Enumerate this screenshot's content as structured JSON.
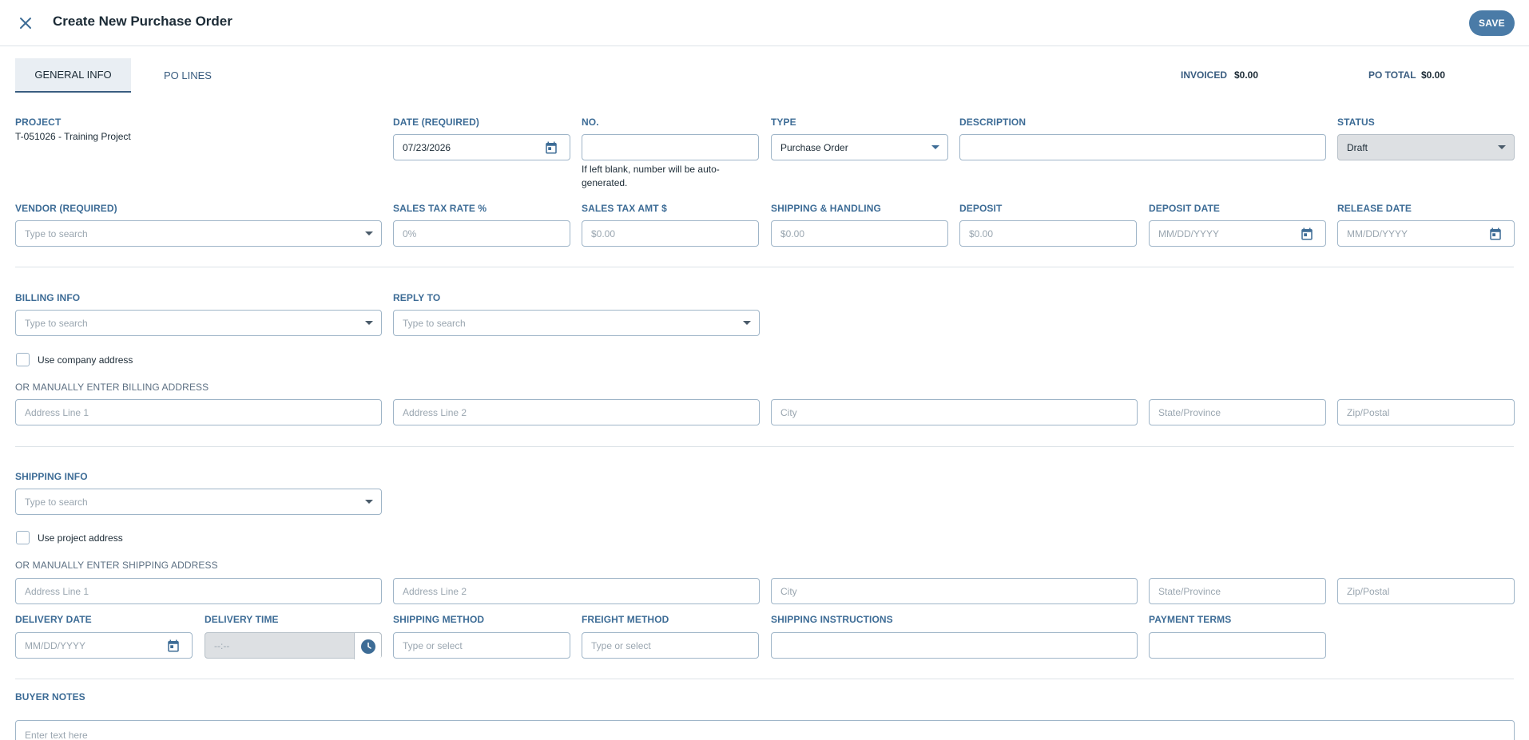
{
  "header": {
    "title": "Create New Purchase Order",
    "save_label": "SAVE"
  },
  "tabs": [
    {
      "label": "GENERAL INFO"
    },
    {
      "label": "PO LINES"
    }
  ],
  "summary": {
    "invoiced_label": "INVOICED",
    "invoiced_value": "$0.00",
    "po_total_label": "PO TOTAL",
    "po_total_value": "$0.00"
  },
  "general": {
    "project_label": "PROJECT",
    "project_value": "T-051026 - Training Project",
    "date_label": "DATE (REQUIRED)",
    "date_value": "07/23/2026",
    "no_label": "NO.",
    "no_hint": "If left blank, number will be auto-generated.",
    "type_label": "TYPE",
    "type_value": "Purchase Order",
    "description_label": "DESCRIPTION",
    "status_label": "STATUS",
    "status_value": "Draft",
    "vendor_label": "VENDOR (REQUIRED)",
    "vendor_placeholder": "Type to search",
    "sales_tax_rate_label": "SALES TAX RATE %",
    "sales_tax_rate_placeholder": "0%",
    "sales_tax_amt_label": "SALES TAX AMT $",
    "sales_tax_amt_placeholder": "$0.00",
    "shipping_handling_label": "SHIPPING & HANDLING",
    "shipping_handling_placeholder": "$0.00",
    "deposit_label": "DEPOSIT",
    "deposit_placeholder": "$0.00",
    "deposit_date_label": "DEPOSIT DATE",
    "deposit_date_placeholder": "MM/DD/YYYY",
    "release_date_label": "RELEASE DATE",
    "release_date_placeholder": "MM/DD/YYYY"
  },
  "billing": {
    "billing_info_label": "BILLING INFO",
    "billing_info_placeholder": "Type to search",
    "reply_to_label": "REPLY TO",
    "reply_to_placeholder": "Type to search",
    "use_company_address_label": "Use company address",
    "manual_label": "OR MANUALLY ENTER BILLING ADDRESS",
    "address1_placeholder": "Address Line 1",
    "address2_placeholder": "Address Line 2",
    "city_placeholder": "City",
    "state_placeholder": "State/Province",
    "zip_placeholder": "Zip/Postal"
  },
  "shipping": {
    "shipping_info_label": "SHIPPING INFO",
    "shipping_info_placeholder": "Type to search",
    "use_project_address_label": "Use project address",
    "manual_label": "OR MANUALLY ENTER SHIPPING ADDRESS",
    "address1_placeholder": "Address Line 1",
    "address2_placeholder": "Address Line 2",
    "city_placeholder": "City",
    "state_placeholder": "State/Province",
    "zip_placeholder": "Zip/Postal",
    "delivery_date_label": "DELIVERY DATE",
    "delivery_date_placeholder": "MM/DD/YYYY",
    "delivery_time_label": "DELIVERY TIME",
    "delivery_time_placeholder": "--:--",
    "shipping_method_label": "SHIPPING METHOD",
    "shipping_method_placeholder": "Type or select",
    "freight_method_label": "FREIGHT METHOD",
    "freight_method_placeholder": "Type or select",
    "shipping_instructions_label": "SHIPPING INSTRUCTIONS",
    "payment_terms_label": "PAYMENT TERMS"
  },
  "notes": {
    "buyer_notes_label": "BUYER NOTES",
    "buyer_notes_placeholder": "Enter text here"
  },
  "colors": {
    "accent": "#3d6c96",
    "save_button": "#4a7ba7",
    "field_border": "#9fb5c8",
    "disabled_field": "#dde0e3"
  }
}
